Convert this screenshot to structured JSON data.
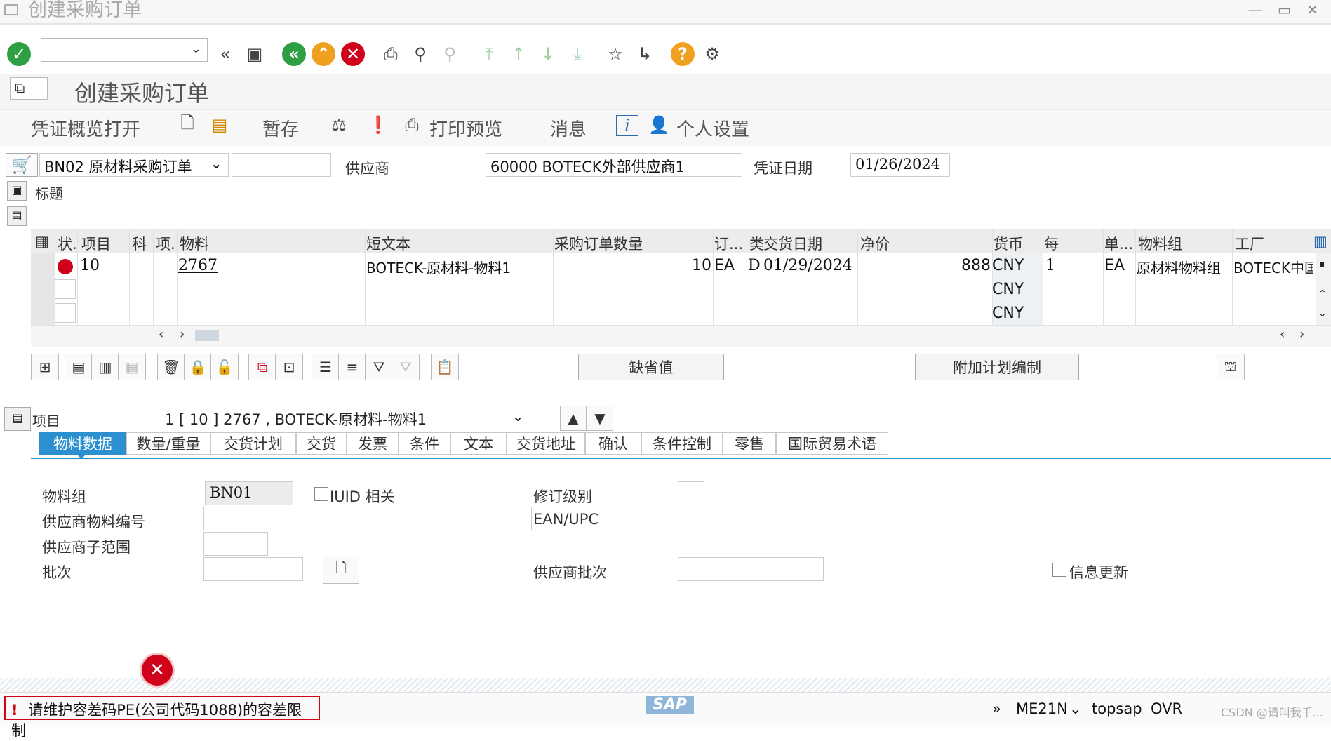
{
  "window": {
    "title": "创建采购订单",
    "controls": "— ▭ ✕"
  },
  "toolbar": {
    "command_field": "",
    "icons": [
      "enter-icon",
      "back-double-icon",
      "save-icon",
      "back-icon",
      "exit-icon",
      "cancel-icon",
      "print-icon",
      "find-icon",
      "find-next-icon",
      "first-page-icon",
      "prev-page-icon",
      "next-page-icon",
      "last-page-icon",
      "new-session-icon",
      "shortcut-icon",
      "help-icon",
      "settings-icon"
    ]
  },
  "page": {
    "title": "创建采购订单"
  },
  "app_toolbar": {
    "doc_overview": "凭证概览打开",
    "hold": "暂存",
    "print_preview": "打印预览",
    "messages": "消息",
    "personal_settings": "个人设置"
  },
  "header": {
    "order_type": "BN02 原材料采购订单",
    "order_number": "",
    "vendor_label": "供应商",
    "vendor_value": "60000 BOTECK外部供应商1",
    "doc_date_label": "凭证日期",
    "doc_date_value": "01/26/2024",
    "header_label": "标题"
  },
  "grid": {
    "columns": [
      "状.",
      "项目",
      "科",
      "项.",
      "物料",
      "短文本",
      "采购订单数量",
      "订...",
      "类",
      "交货日期",
      "净价",
      "货币",
      "每",
      "单...",
      "物料组",
      "工厂"
    ],
    "rows": [
      {
        "item": "10",
        "material": "2767",
        "short_text": "BOTECK-原材料-物料1",
        "qty": "10",
        "unit": "EA",
        "cat": "D",
        "delivery_date": "01/29/2024",
        "net_price": "888",
        "currency": "CNY",
        "per": "1",
        "uom": "EA",
        "matl_group": "原材料物料组",
        "plant": "BOTECK中国"
      },
      {
        "currency": "CNY"
      },
      {
        "currency": "CNY"
      }
    ]
  },
  "grid_toolbar": {
    "default_values": "缺省值",
    "addl_planning": "附加计划编制"
  },
  "item_detail": {
    "label": "项目",
    "selected": "1 [ 10 ] 2767 , BOTECK-原材料-物料1",
    "tabs": [
      "物料数据",
      "数量/重量",
      "交货计划",
      "交货",
      "发票",
      "条件",
      "文本",
      "交货地址",
      "确认",
      "条件控制",
      "零售",
      "国际贸易术语"
    ],
    "active_tab": "物料数据",
    "fields": {
      "matl_group_label": "物料组",
      "matl_group_value": "BN01",
      "iuid_label": "IUID 相关",
      "revision_label": "修订级别",
      "vendor_mat_label": "供应商物料编号",
      "ean_label": "EAN/UPC",
      "vendor_sub_label": "供应商子范围",
      "batch_label": "批次",
      "vendor_batch_label": "供应商批次",
      "info_update_label": "信息更新"
    }
  },
  "status": {
    "message": "请维护容差码PE(公司代码1088)的容差限制",
    "logo": "SAP",
    "tcode": "ME21N",
    "server": "topsap",
    "mode": "OVR",
    "watermark": "CSDN @请叫我千..."
  }
}
